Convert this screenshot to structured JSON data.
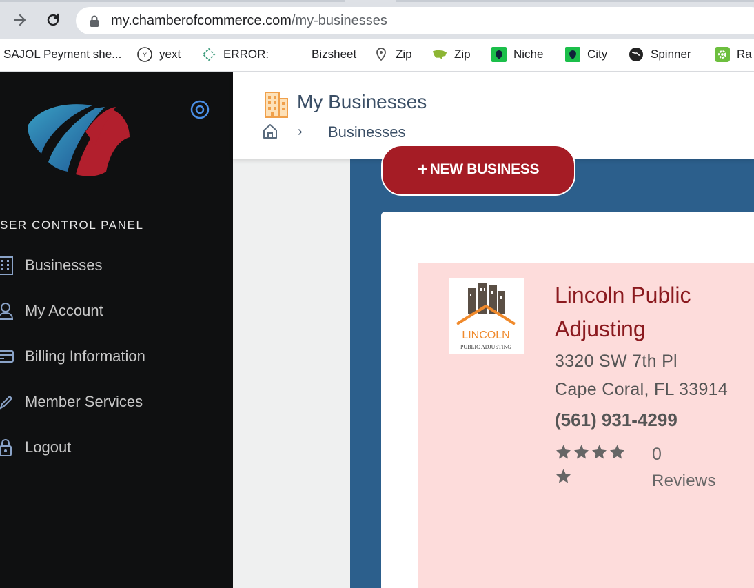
{
  "browser": {
    "url_host": "my.chamberofcommerce.com",
    "url_path": "/my-businesses",
    "bookmarks": [
      "SAJOL Peyment she...",
      "yext",
      "ERROR:",
      "Bizsheet",
      "Zip",
      "Zip",
      "Niche",
      "City",
      "Spinner",
      "Ra"
    ]
  },
  "sidebar": {
    "panel_title": "SER CONTROL PANEL",
    "items": [
      {
        "label": "Businesses",
        "icon": "building-icon"
      },
      {
        "label": "My Account",
        "icon": "user-icon"
      },
      {
        "label": "Billing Information",
        "icon": "credit-card-icon"
      },
      {
        "label": "Member Services",
        "icon": "pen-icon"
      },
      {
        "label": "Logout",
        "icon": "lock-icon"
      }
    ]
  },
  "header": {
    "title": "My Businesses",
    "breadcrumb_current": "Businesses",
    "breadcrumb_sep": "›"
  },
  "actions": {
    "new_business_label": "NEW BUSINESS",
    "new_business_plus": "+"
  },
  "business": {
    "name": "Lincoln Public Adjusting",
    "address_line1": "3320 SW 7th Pl",
    "address_line2": "Cape Coral, FL 33914",
    "phone": "(561) 931-4299",
    "rating_stars": 5,
    "reviews_count": "0",
    "reviews_label": "Reviews",
    "logo_text": "LINCOLN",
    "logo_subtext": "PUBLIC ADJUSTING"
  },
  "colors": {
    "sidebar_bg": "#0f1011",
    "accent_red": "#a51c25",
    "blue_panel": "#2c5f8c",
    "card_pink": "#fddcdb",
    "title_text": "#3b4f66"
  }
}
